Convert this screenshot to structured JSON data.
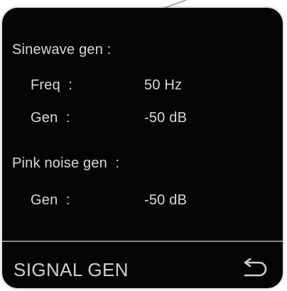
{
  "screen": {
    "sinewave": {
      "heading": "Sinewave gen :",
      "freq_label": "Freq  :",
      "freq_value": "50 Hz",
      "gen_label": "Gen  :",
      "gen_value": "-50 dB"
    },
    "pink_noise": {
      "heading": "Pink noise gen  :",
      "gen_label": "Gen  :",
      "gen_value": "-50 dB"
    },
    "footer": {
      "title": "SIGNAL GEN",
      "back_icon": "return-arrow-icon"
    }
  },
  "colors": {
    "screen_bg": "#050505",
    "text": "#d8d8d8",
    "divider": "#8a8a8a"
  }
}
